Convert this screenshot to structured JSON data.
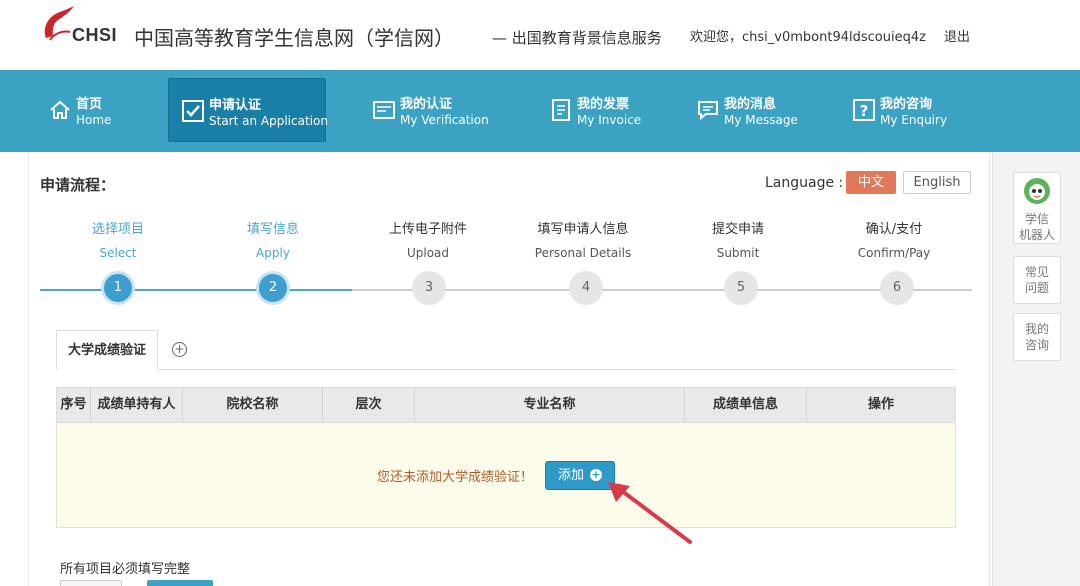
{
  "header": {
    "logo_text": "CHSI",
    "site_title": "中国高等教育学生信息网（学信网）",
    "site_subtitle": "— 出国教育背景信息服务",
    "welcome": "欢迎您，chsi_v0mbont94ldscouieq4z",
    "logout": "退出"
  },
  "nav": {
    "items": [
      {
        "cn": "首页",
        "en": "Home",
        "icon": "home-icon"
      },
      {
        "cn": "申请认证",
        "en": "Start an Application",
        "icon": "checkbox-icon"
      },
      {
        "cn": "我的认证",
        "en": "My Verification",
        "icon": "certificate-icon"
      },
      {
        "cn": "我的发票",
        "en": "My Invoice",
        "icon": "invoice-icon"
      },
      {
        "cn": "我的消息",
        "en": "My Message",
        "icon": "message-icon"
      },
      {
        "cn": "我的咨询",
        "en": "My Enquiry",
        "icon": "question-icon"
      }
    ],
    "active_index": 1
  },
  "process": {
    "title": "申请流程：",
    "language_label": "Language :",
    "lang_zh": "中文",
    "lang_en": "English",
    "steps": [
      {
        "cn": "选择项目",
        "en": "Select",
        "num": "1",
        "done": true
      },
      {
        "cn": "填写信息",
        "en": "Apply",
        "num": "2",
        "done": true
      },
      {
        "cn": "上传电子附件",
        "en": "Upload",
        "num": "3",
        "done": false
      },
      {
        "cn": "填写申请人信息",
        "en": "Personal Details",
        "num": "4",
        "done": false
      },
      {
        "cn": "提交申请",
        "en": "Submit",
        "num": "5",
        "done": false
      },
      {
        "cn": "确认/支付",
        "en": "Confirm/Pay",
        "num": "6",
        "done": false
      }
    ]
  },
  "tabs": {
    "active_label": "大学成绩验证",
    "add_symbol": "⊕"
  },
  "table": {
    "columns": [
      "序号",
      "成绩单持有人",
      "院校名称",
      "层次",
      "专业名称",
      "成绩单信息",
      "操作"
    ],
    "empty_message": "您还未添加大学成绩验证！",
    "add_button": "添加"
  },
  "footer": {
    "note": "所有项目必须填写完整"
  },
  "side": {
    "robot": "学信\n机器人",
    "faq": "常见\n问题",
    "my_enquiry": "我的\n咨询"
  },
  "colors": {
    "nav_bg": "#3ba2c3",
    "nav_active": "#1a7fa6",
    "step_done": "#3d9fd0",
    "lang_zh_bg": "#e0795a",
    "empty_bg": "#fdfbe9"
  }
}
